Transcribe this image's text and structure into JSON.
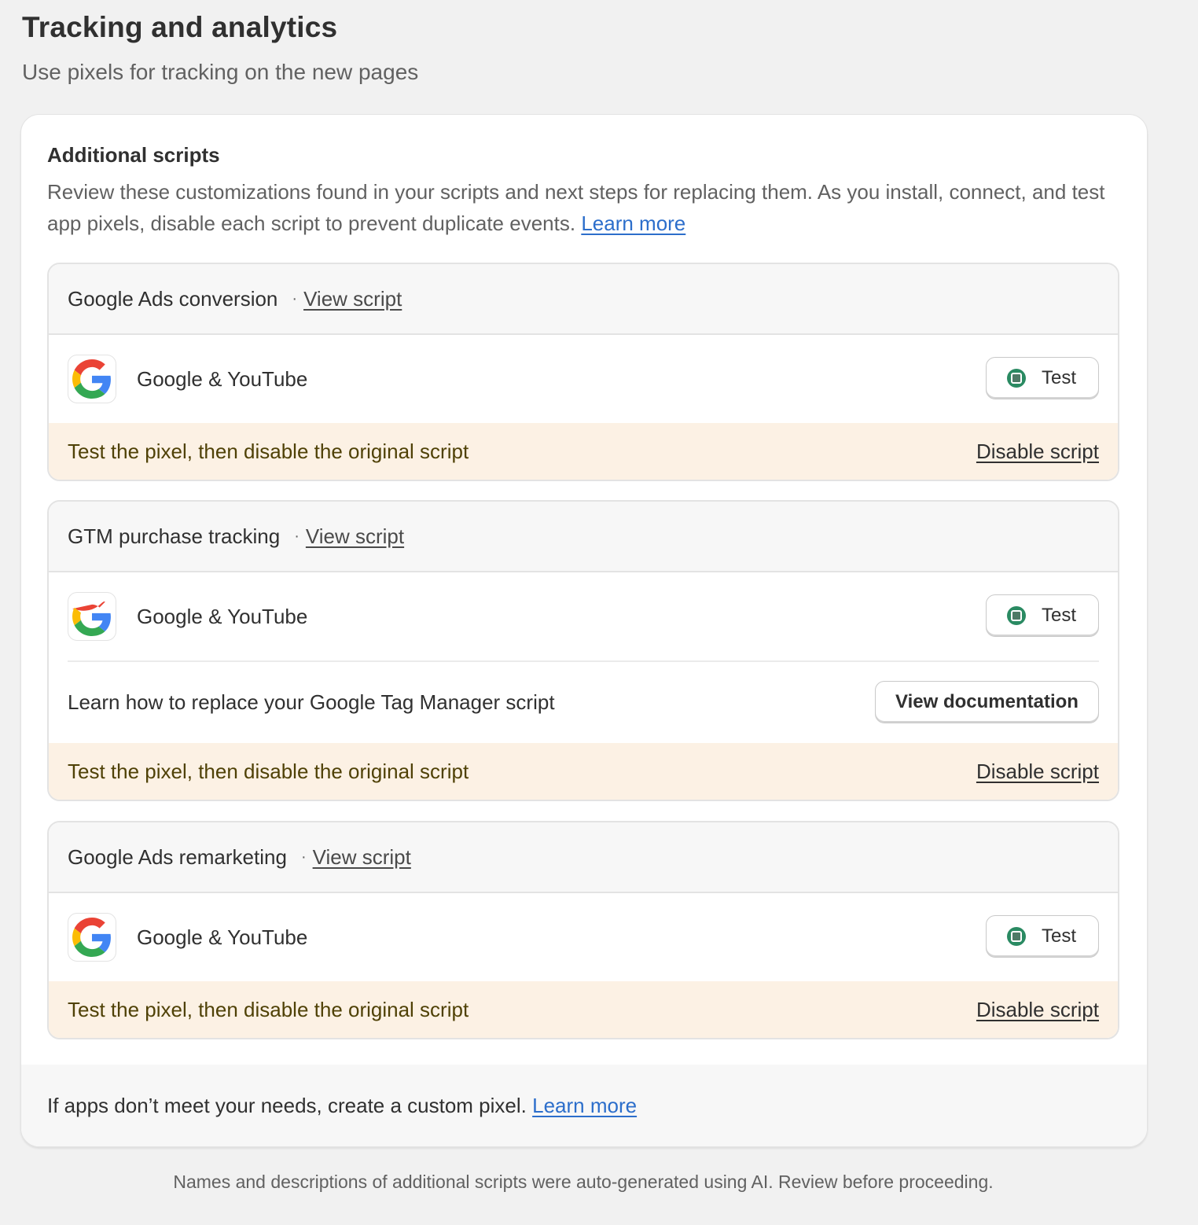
{
  "page": {
    "title": "Tracking and analytics",
    "subtitle": "Use pixels for tracking on the new pages"
  },
  "card": {
    "title": "Additional scripts",
    "description": "Review these customizations found in your scripts and next steps for replacing them. As you install, connect, and test app pixels, disable each script to prevent duplicate events.",
    "learn_more": "Learn more"
  },
  "scripts": [
    {
      "name": "Google Ads conversion",
      "separator": "·",
      "view_label": "View script",
      "app_name": "Google & YouTube",
      "test_label": "Test",
      "warning": "Test the pixel, then disable the original script",
      "disable_label": "Disable script"
    },
    {
      "name": "GTM purchase tracking",
      "separator": "·",
      "view_label": "View script",
      "app_name": "Google & YouTube",
      "test_label": "Test",
      "doc_text": "Learn how to replace your Google Tag Manager script",
      "doc_button": "View documentation",
      "warning": "Test the pixel, then disable the original script",
      "disable_label": "Disable script"
    },
    {
      "name": "Google Ads remarketing",
      "separator": "·",
      "view_label": "View script",
      "app_name": "Google & YouTube",
      "test_label": "Test",
      "warning": "Test the pixel, then disable the original script",
      "disable_label": "Disable script"
    }
  ],
  "footer": {
    "text": "If apps don’t meet your needs, create a custom pixel.",
    "learn_more": "Learn more"
  },
  "note": "Names and descriptions of additional scripts were auto-generated using AI. Review before proceeding.",
  "icons": {
    "app": "google-g-logo",
    "test_status": "status-dot-icon"
  },
  "colors": {
    "link": "#2c6ecb",
    "warning_bg": "#fcf1e4",
    "warning_text": "#4f4106",
    "status_green": "#2a8a62",
    "page_bg": "#f1f1f1"
  }
}
